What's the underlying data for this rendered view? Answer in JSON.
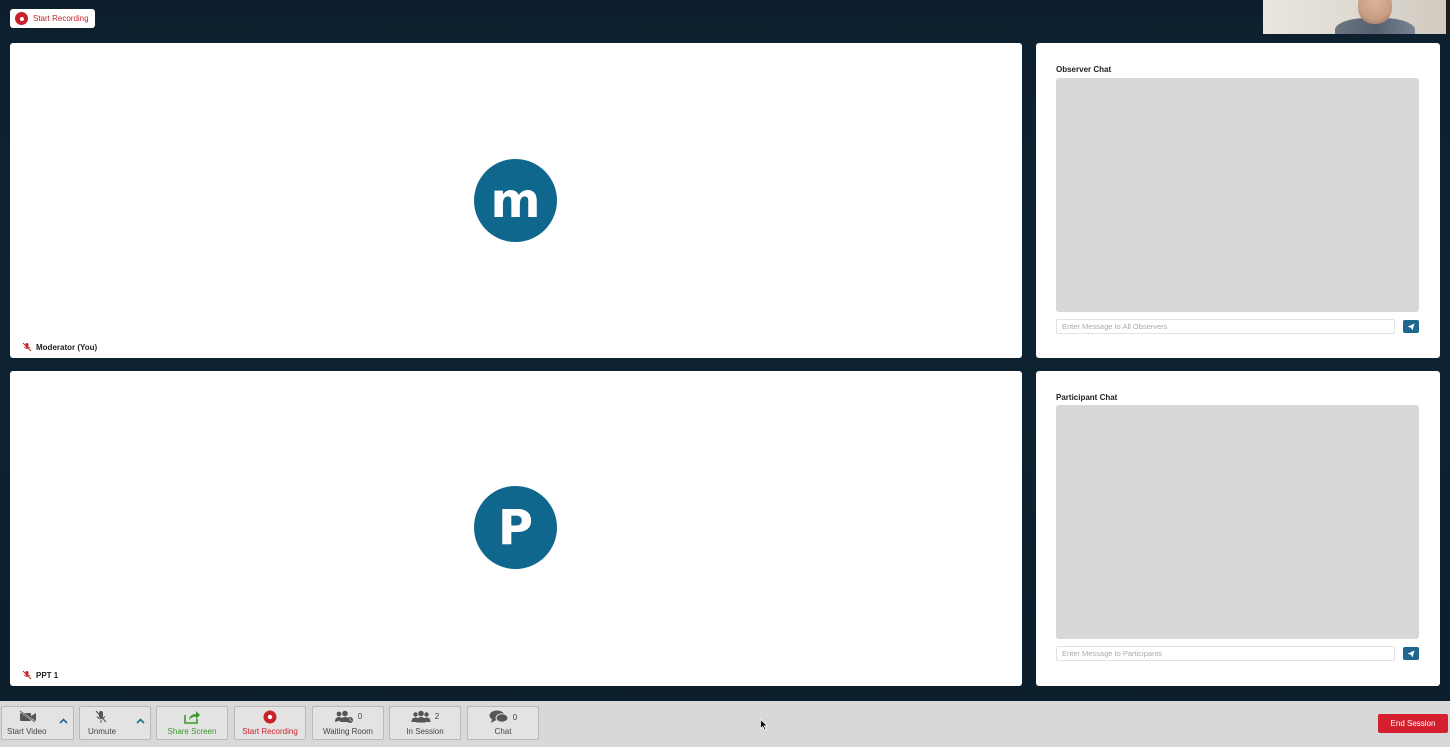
{
  "top": {
    "record_label": "Start Recording"
  },
  "videos": [
    {
      "initial": "m",
      "name": "Moderator (You)"
    },
    {
      "initial": "P",
      "name": "PPT 1"
    }
  ],
  "observer_chat": {
    "title": "Observer Chat",
    "placeholder": "Enter Message to All Observers"
  },
  "participant_chat": {
    "title": "Participant Chat",
    "placeholder": "Enter Message to Participants"
  },
  "toolbar": {
    "start_video": "Start Video",
    "unmute": "Unmute",
    "share_screen": "Share Screen",
    "start_recording": "Start Recording",
    "waiting_room": "Waiting Room",
    "waiting_count": "0",
    "in_session": "In Session",
    "in_session_count": "2",
    "chat": "Chat",
    "chat_count": "0",
    "end_session": "End Session"
  },
  "colors": {
    "accent": "#10678d",
    "record_red": "#c8232c",
    "share_green": "#3a9a2a",
    "end_red": "#d31f2e"
  }
}
